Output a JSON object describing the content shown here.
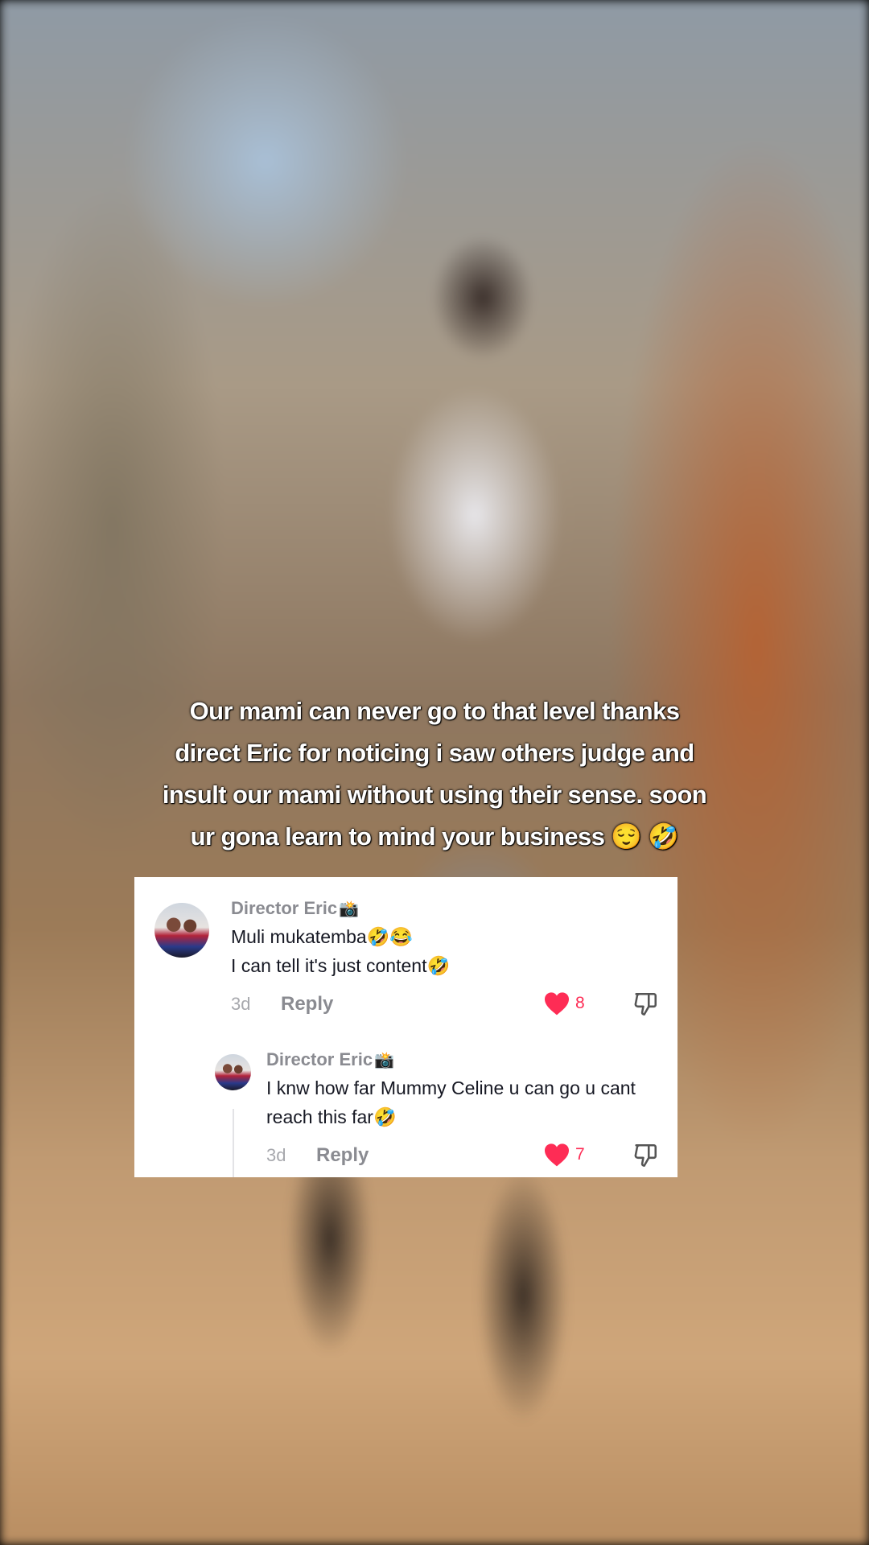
{
  "caption": {
    "lines": [
      "Our mami can never go to that level thanks",
      "direct Eric for noticing  i saw others judge and",
      "insult our mami without using their sense. soon",
      "ur gona learn to mind your business 😌 🤣"
    ]
  },
  "comment": {
    "username": "Director Eric",
    "username_emoji": "📸",
    "text_line1": "Muli mukatemba🤣😂",
    "text_line2": "I can tell it's just content🤣",
    "age": "3d",
    "reply_label": "Reply",
    "like_count": "8"
  },
  "reply": {
    "username": "Director Eric",
    "username_emoji": "📸",
    "text": "I knw how far Mummy Celine u can go u cant reach this far🤣",
    "age": "3d",
    "reply_label": "Reply",
    "like_count": "7"
  },
  "colors": {
    "like": "#fe2c55",
    "username": "#8a8b91",
    "comment_text": "#161823",
    "card_bg": "#ffffff"
  },
  "icons": {
    "like": "heart-icon",
    "dislike": "thumbs-down-icon"
  }
}
